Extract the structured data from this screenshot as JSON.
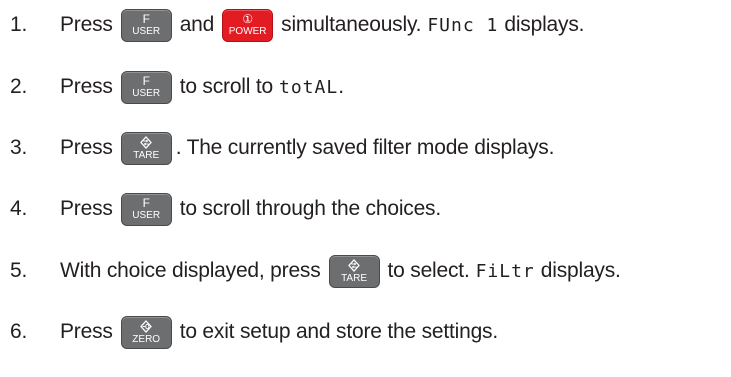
{
  "steps": [
    {
      "num": "1.",
      "t1": "Press",
      "k1": {
        "top": "F",
        "bottom": "USER"
      },
      "t2": "and",
      "k2": {
        "top": "①",
        "bottom": "POWER"
      },
      "t3": "simultaneously.",
      "display": "FUnc 1",
      "t4": "displays."
    },
    {
      "num": "2.",
      "t1": "Press",
      "k1": {
        "top": "F",
        "bottom": "USER"
      },
      "t2": "to scroll to",
      "display": "totAL",
      "t3": "."
    },
    {
      "num": "3.",
      "t1": "Press",
      "k1": {
        "icon": "tare-icon",
        "bottom": "TARE"
      },
      "t2": ". The currently saved filter mode displays."
    },
    {
      "num": "4.",
      "t1": "Press",
      "k1": {
        "top": "F",
        "bottom": "USER"
      },
      "t2": "to scroll through the choices."
    },
    {
      "num": "5.",
      "t1": "With choice displayed, press",
      "k1": {
        "icon": "tare-icon",
        "bottom": "TARE"
      },
      "t2": "to select.",
      "display": "FiLtr",
      "t3": "displays."
    },
    {
      "num": "6.",
      "t1": "Press",
      "k1": {
        "icon": "zero-icon",
        "bottom": "ZERO"
      },
      "t2": "to exit setup and store the settings."
    }
  ]
}
